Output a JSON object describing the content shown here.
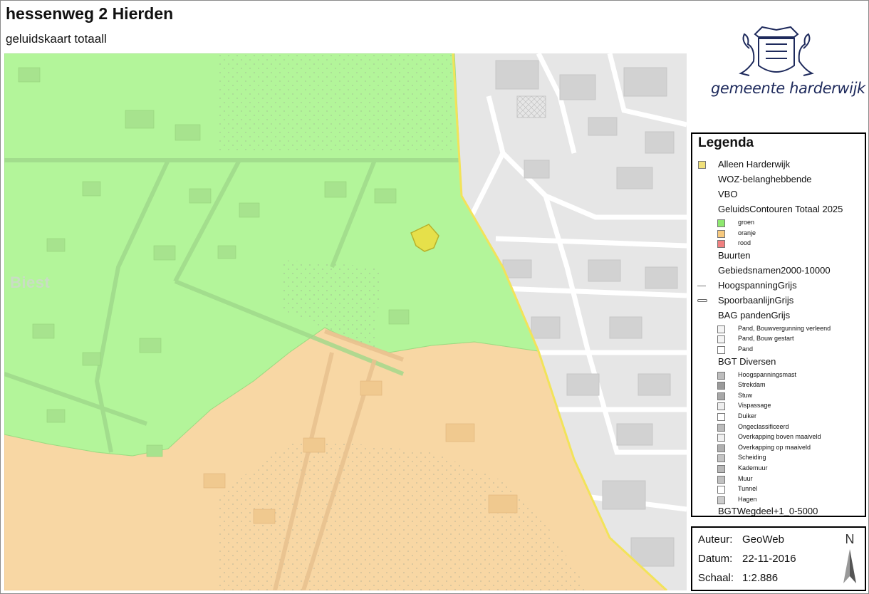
{
  "header": {
    "title": "hessenweg 2 Hierden",
    "subtitle": "geluidskaart totaall"
  },
  "map": {
    "place_label": "Biest",
    "colors": {
      "groen": "#b3f59a",
      "oranje": "#f8d7a4",
      "highlight": "#e6e04a",
      "base": "#e8e8e8"
    }
  },
  "logo": {
    "text": "gemeente harderwijk",
    "icon": "coat-of-arms"
  },
  "legend": {
    "title": "Legenda",
    "items": [
      {
        "label": "Alleen Harderwijk",
        "level": "group",
        "swatch": "#f0e07a"
      },
      {
        "label": "WOZ-belanghebbende",
        "level": "group"
      },
      {
        "label": "VBO",
        "level": "group"
      },
      {
        "label": "GeluidsContouren Totaal 2025",
        "level": "group"
      },
      {
        "label": "groen",
        "level": "sub",
        "swatch": "#8ee86f"
      },
      {
        "label": "oranje",
        "level": "sub",
        "swatch": "#f7c97e"
      },
      {
        "label": "rood",
        "level": "sub",
        "swatch": "#f08080"
      },
      {
        "label": "Buurten",
        "level": "group"
      },
      {
        "label": "Gebiedsnamen2000-10000",
        "level": "group"
      },
      {
        "label": "HoogspanningGrijs",
        "level": "group",
        "symbol": "line"
      },
      {
        "label": "SpoorbaanlijnGrijs",
        "level": "group",
        "symbol": "rail"
      },
      {
        "label": "BAG pandenGrijs",
        "level": "group"
      },
      {
        "label": "Pand, Bouwvergunning verleend",
        "level": "sub",
        "swatch": "#f4f4f4"
      },
      {
        "label": "Pand, Bouw gestart",
        "level": "sub",
        "swatch": "#f4f4f4"
      },
      {
        "label": "Pand",
        "level": "sub",
        "swatch": "#ffffff"
      },
      {
        "label": "BGT Diversen",
        "level": "group"
      },
      {
        "label": "Hoogspanningsmast",
        "level": "sub",
        "swatch": "#bdbdbd"
      },
      {
        "label": "Strekdam",
        "level": "sub",
        "swatch": "#9a9a9a"
      },
      {
        "label": "Stuw",
        "level": "sub",
        "swatch": "#a8a8a8"
      },
      {
        "label": "Vispassage",
        "level": "sub",
        "swatch": "#eeeeee"
      },
      {
        "label": "Duiker",
        "level": "sub",
        "swatch": "#ffffff"
      },
      {
        "label": "Ongeclassificeerd",
        "level": "sub",
        "swatch": "#bbbbbb"
      },
      {
        "label": "Overkapping boven maaiveld",
        "level": "sub",
        "swatch": "#f0f0f0"
      },
      {
        "label": "Overkapping op maaiveld",
        "level": "sub",
        "swatch": "#b0b0b0"
      },
      {
        "label": "Scheiding",
        "level": "sub",
        "swatch": "#c4c4c4"
      },
      {
        "label": "Kademuur",
        "level": "sub",
        "swatch": "#b8b8b8"
      },
      {
        "label": "Muur",
        "level": "sub",
        "swatch": "#c0c0c0"
      },
      {
        "label": "Tunnel",
        "level": "sub",
        "swatch": "#ffffff"
      },
      {
        "label": "Hagen",
        "level": "sub",
        "swatch": "#cccccc"
      },
      {
        "label": "BGTWegdeel+1_0-5000",
        "level": "group"
      }
    ]
  },
  "info": {
    "auteur_label": "Auteur:",
    "auteur": "GeoWeb",
    "datum_label": "Datum:",
    "datum": "22-11-2016",
    "schaal_label": "Schaal:",
    "schaal": "1:2.886",
    "north_label": "N"
  }
}
